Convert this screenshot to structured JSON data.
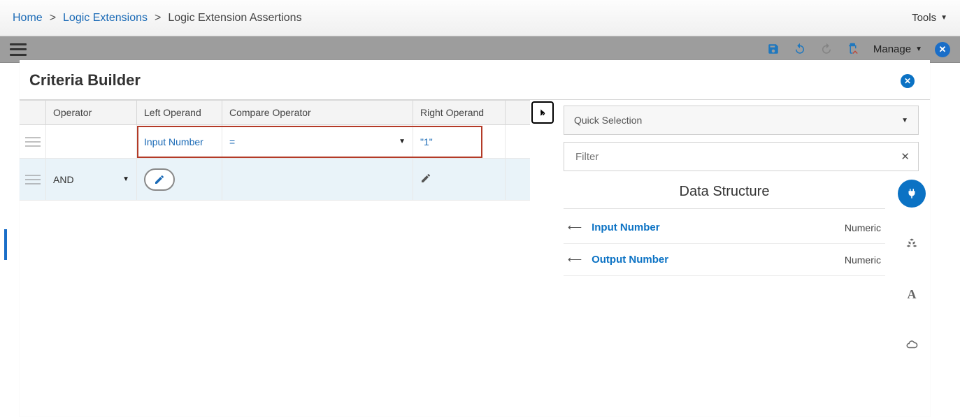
{
  "breadcrumb": {
    "home": "Home",
    "logic_ext": "Logic Extensions",
    "current": "Logic Extension Assertions",
    "tools": "Tools"
  },
  "toolbar": {
    "manage": "Manage"
  },
  "dialog": {
    "title": "Criteria Builder"
  },
  "table": {
    "headers": {
      "operator": "Operator",
      "left": "Left Operand",
      "compare": "Compare Operator",
      "right": "Right Operand"
    },
    "row1": {
      "left": "Input Number",
      "compare": "=",
      "right": "\"1\""
    },
    "row2": {
      "operator": "AND"
    }
  },
  "side": {
    "quick": "Quick Selection",
    "filter_placeholder": "Filter",
    "heading": "Data Structure",
    "items": [
      {
        "name": "Input Number",
        "type": "Numeric"
      },
      {
        "name": "Output Number",
        "type": "Numeric"
      }
    ]
  }
}
